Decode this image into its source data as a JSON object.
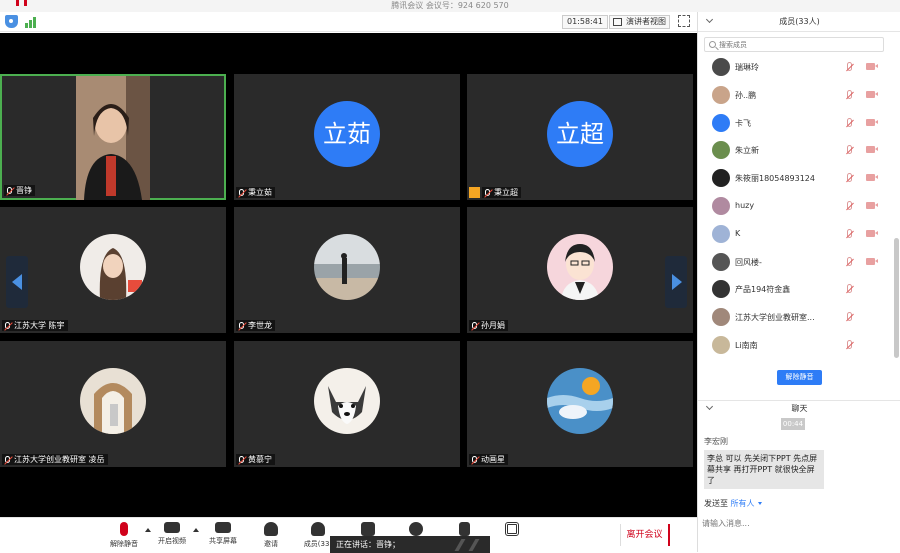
{
  "window": {
    "title": "腾讯会议 会议号：924 620 570"
  },
  "topbar": {
    "timer": "01:58:41",
    "view_label": "演讲者视图"
  },
  "tiles": [
    {
      "name": "晋铮",
      "kind": "video"
    },
    {
      "name": "秉立茹",
      "kind": "text",
      "avatar_text": "立茹"
    },
    {
      "name": "秉立超",
      "kind": "text",
      "avatar_text": "立超",
      "host": true
    },
    {
      "name": "江苏大学 陈宇",
      "kind": "photo"
    },
    {
      "name": "李世龙",
      "kind": "photo"
    },
    {
      "name": "孙月娟",
      "kind": "photo"
    },
    {
      "name": "江苏大学创业教研室 凌岳",
      "kind": "photo"
    },
    {
      "name": "黄慕宁",
      "kind": "photo"
    },
    {
      "name": "动画星",
      "kind": "photo"
    }
  ],
  "toolbar": {
    "unmute_label": "解除静音",
    "video_label": "开启视频",
    "share_label": "共享屏幕",
    "invite_label": "邀请",
    "members_label": "成员(33)",
    "leave_label": "离开会议",
    "speaking_text": "正在讲话：晋铮；"
  },
  "panel": {
    "members_title": "成员(33人)",
    "search_placeholder": "搜索成员",
    "members": [
      "瑞琳玲",
      "孙..鹏",
      "卡飞",
      "朱立新",
      "朱筱丽18054893124",
      "huzy",
      "K",
      "回风楼-",
      "产品194符金鑫",
      "江苏大学创业教研室...",
      "Li南南"
    ],
    "unmute_all_label": "解除静音",
    "chat_title": "聊天",
    "chat_time": "00:44",
    "chat_sender": "李宏刚",
    "chat_message": "李总 可以 先关闭下PPT 先点屏幕共享 再打开PPT 就很快全屏了",
    "send_to_label": "发送至",
    "send_to_target": "所有人",
    "chat_placeholder": "请输入消息..."
  },
  "colors": {
    "accent": "#2e7cf6",
    "leave": "#d0021b",
    "active_speaker": "#4caf50"
  }
}
